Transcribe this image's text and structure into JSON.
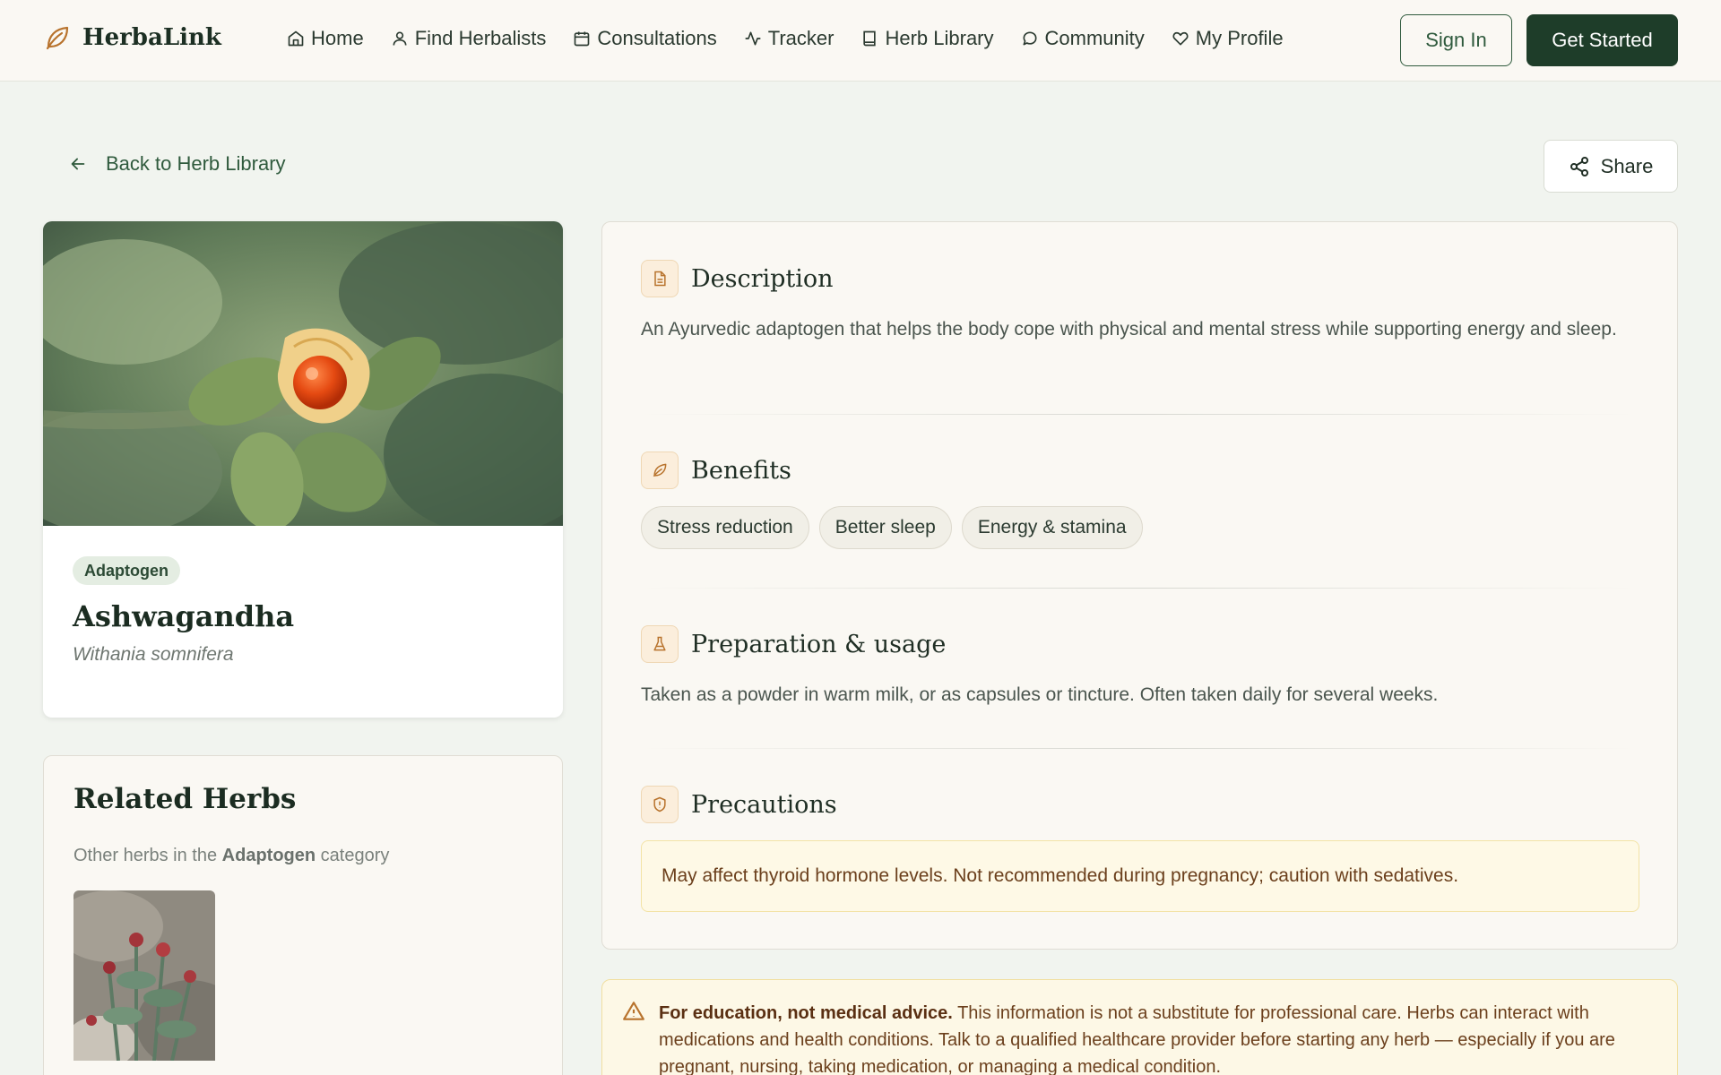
{
  "header": {
    "brand": "HerbaLink",
    "nav": [
      {
        "label": "Home",
        "icon": "home-icon"
      },
      {
        "label": "Find Herbalists",
        "icon": "user-icon"
      },
      {
        "label": "Consultations",
        "icon": "calendar-icon"
      },
      {
        "label": "Tracker",
        "icon": "activity-icon"
      },
      {
        "label": "Herb Library",
        "icon": "book-icon"
      },
      {
        "label": "Community",
        "icon": "chat-bubble-icon"
      },
      {
        "label": "My Profile",
        "icon": "heart-icon"
      }
    ],
    "sign_in": "Sign In",
    "get_started": "Get Started"
  },
  "back_link": "Back to Herb Library",
  "share_label": "Share",
  "herb": {
    "tag": "Adaptogen",
    "name": "Ashwagandha",
    "latin": "Withania somnifera"
  },
  "related": {
    "title": "Related Herbs",
    "subtitle_prefix": "Other herbs in the",
    "category": "Adaptogen",
    "subtitle_suffix": "category"
  },
  "sections": {
    "description": {
      "title": "Description",
      "text": "An Ayurvedic adaptogen that helps the body cope with physical and mental stress while supporting energy and sleep."
    },
    "benefits": {
      "title": "Benefits",
      "items": [
        "Stress reduction",
        "Better sleep",
        "Energy & stamina"
      ]
    },
    "preparation": {
      "title": "Preparation & usage",
      "text": "Taken as a powder in warm milk, or as capsules or tincture. Often taken daily for several weeks."
    },
    "precautions": {
      "title": "Precautions",
      "text": "May affect thyroid hormone levels. Not recommended during pregnancy; caution with sedatives."
    }
  },
  "disclaimer": {
    "bold": "For education, not medical advice.",
    "text": "This information is not a substitute for professional care. Herbs can interact with medications and health conditions. Talk to a qualified healthcare provider before starting any herb — especially if you are pregnant, nursing, taking medication, or managing a medical condition."
  },
  "colors": {
    "brand_dark": "#1e3d29",
    "brand_green": "#2f5a3d",
    "accent_orange": "#b8732d",
    "warning_bg": "#fdf8e6"
  }
}
